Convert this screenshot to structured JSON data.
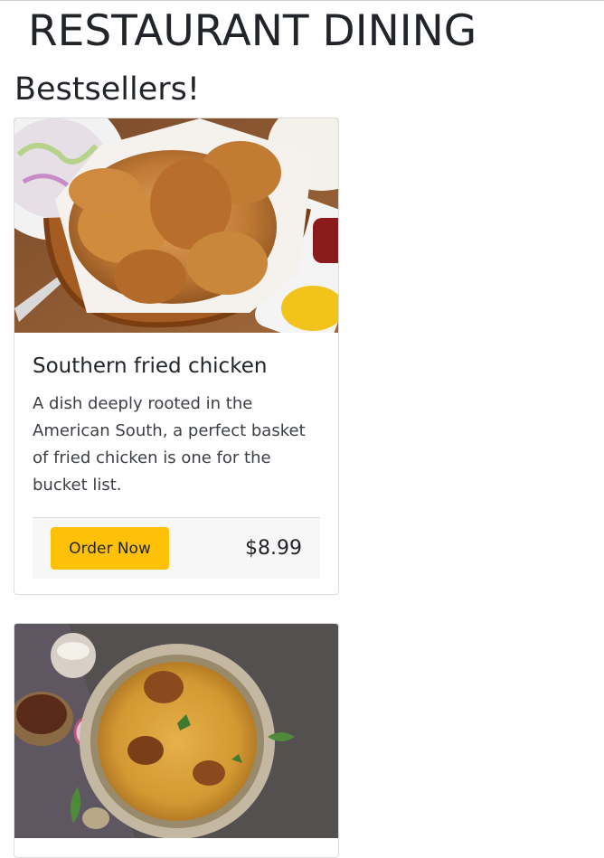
{
  "header": {
    "title": "RESTAURANT DINING"
  },
  "section": {
    "title": "Bestsellers!"
  },
  "cards": [
    {
      "image_alt": "Basket of fried chicken",
      "title": "Southern fried chicken",
      "description": "A dish deeply rooted in the American South, a perfect basket of fried chicken is one for the bucket list.",
      "button_label": "Order Now",
      "price": "$8.99"
    },
    {
      "image_alt": "Plate of biryani"
    }
  ],
  "colors": {
    "accent": "#ffc107",
    "card_border": "#dcdcdc",
    "footer_bg": "#f7f7f7"
  }
}
